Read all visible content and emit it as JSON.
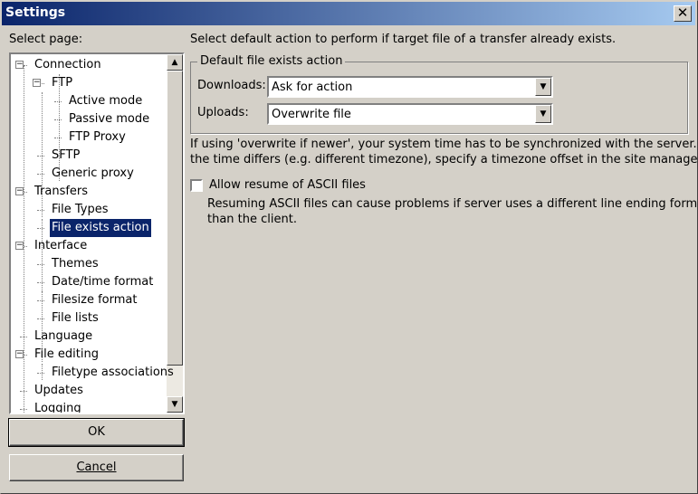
{
  "window": {
    "title": "Settings",
    "close": "✕"
  },
  "tree": {
    "label": "Select page:",
    "items": [
      {
        "label": "Connection",
        "level": 0,
        "expand": "−"
      },
      {
        "label": "FTP",
        "level": 1,
        "expand": "−"
      },
      {
        "label": "Active mode",
        "level": 2
      },
      {
        "label": "Passive mode",
        "level": 2
      },
      {
        "label": "FTP Proxy",
        "level": 2
      },
      {
        "label": "SFTP",
        "level": 1
      },
      {
        "label": "Generic proxy",
        "level": 1
      },
      {
        "label": "Transfers",
        "level": 0,
        "expand": "−"
      },
      {
        "label": "File Types",
        "level": 1
      },
      {
        "label": "File exists action",
        "level": 1,
        "selected": true
      },
      {
        "label": "Interface",
        "level": 0,
        "expand": "−"
      },
      {
        "label": "Themes",
        "level": 1
      },
      {
        "label": "Date/time format",
        "level": 1
      },
      {
        "label": "Filesize format",
        "level": 1
      },
      {
        "label": "File lists",
        "level": 1
      },
      {
        "label": "Language",
        "level": 0
      },
      {
        "label": "File editing",
        "level": 0,
        "expand": "−"
      },
      {
        "label": "Filetype associations",
        "level": 1
      },
      {
        "label": "Updates",
        "level": 0
      },
      {
        "label": "Logging",
        "level": 0
      }
    ]
  },
  "buttons": {
    "ok": "OK",
    "cancel": "Cancel"
  },
  "main": {
    "intro": "Select default action to perform if target file of a transfer already exists.",
    "group_title": "Default file exists action",
    "downloads_label": "Downloads:",
    "downloads_value": "Ask for action",
    "uploads_label": "Uploads:",
    "uploads_value": "Overwrite file",
    "note1": "If using 'overwrite if newer', your system time has to be synchronized with the server. If",
    "note2": "the time differs (e.g. different timezone), specify a timezone offset in the site manager.",
    "ascii_label": "Allow resume of ASCII files",
    "ascii_checked": false,
    "ascii_note1": "Resuming ASCII files can cause problems if server uses a different line ending format",
    "ascii_note2": "than the client."
  }
}
